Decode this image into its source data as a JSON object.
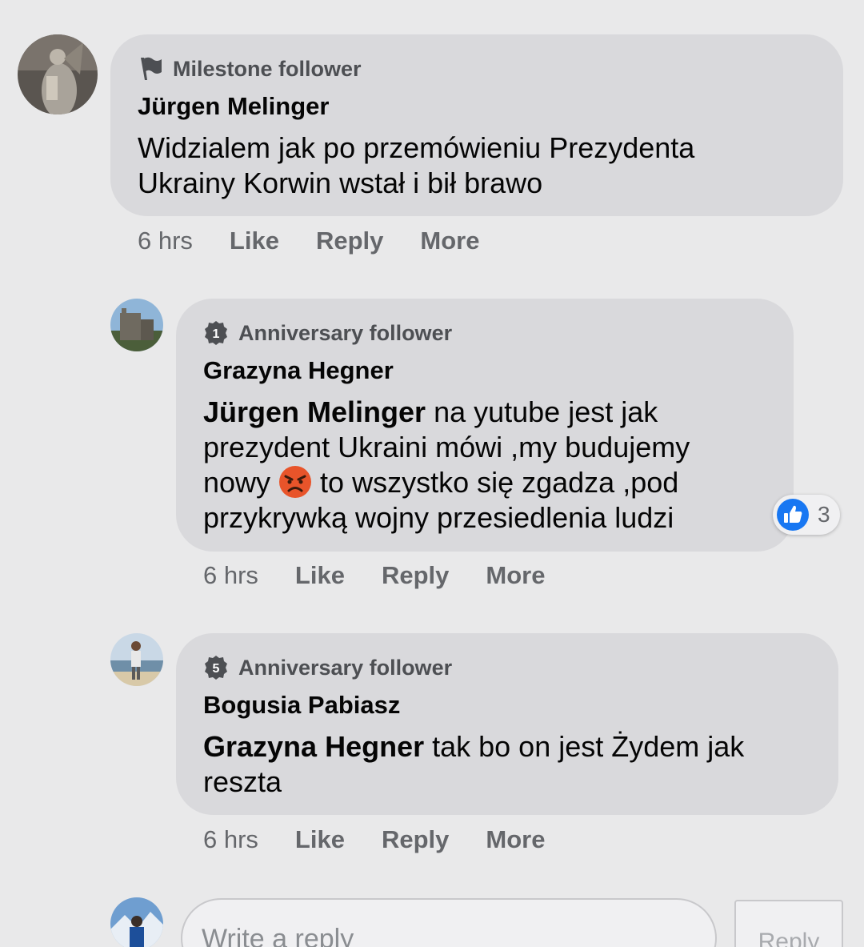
{
  "comments": [
    {
      "badge": "Milestone follower",
      "badge_icon": "flag-icon",
      "author": "Jürgen Melinger",
      "mention": "",
      "text_lines": [
        "Widzialem jak po przemówieniu Prezydenta",
        "Ukrainy Korwin wstał i bił brawo"
      ],
      "time": "6 hrs",
      "like": "Like",
      "reply": "Reply",
      "more": "More"
    },
    {
      "badge": "Anniversary follower",
      "badge_icon": "anniversary-1-icon",
      "badge_number": "1",
      "author": "Grazyna Hegner",
      "mention": "Jürgen Melinger",
      "text_line1_rest": " na yutube jest jak",
      "text_line2": "prezydent Ukraini mówi ,my budujemy",
      "text_line3_before": "nowy ",
      "text_line3_after": " to wszystko się zgadza ,pod",
      "text_line4": "przykrywką wojny przesiedlenia ludzi",
      "reaction_count": "3",
      "time": "6 hrs",
      "like": "Like",
      "reply": "Reply",
      "more": "More"
    },
    {
      "badge": "Anniversary follower",
      "badge_icon": "anniversary-5-icon",
      "badge_number": "5",
      "author": "Bogusia Pabiasz",
      "mention": "Grazyna Hegner",
      "text_line1_rest": " tak bo on jest Żydem jak",
      "text_line2": "reszta",
      "time": "6 hrs",
      "like": "Like",
      "reply": "Reply",
      "more": "More"
    }
  ],
  "composer": {
    "placeholder": "Write a reply",
    "button": "Reply"
  },
  "colors": {
    "background": "#e9e9ea",
    "bubble": "#d9d9dc",
    "secondary_text": "#65676b",
    "like_blue": "#1877f2",
    "angry_emoji": "#e8542a"
  }
}
